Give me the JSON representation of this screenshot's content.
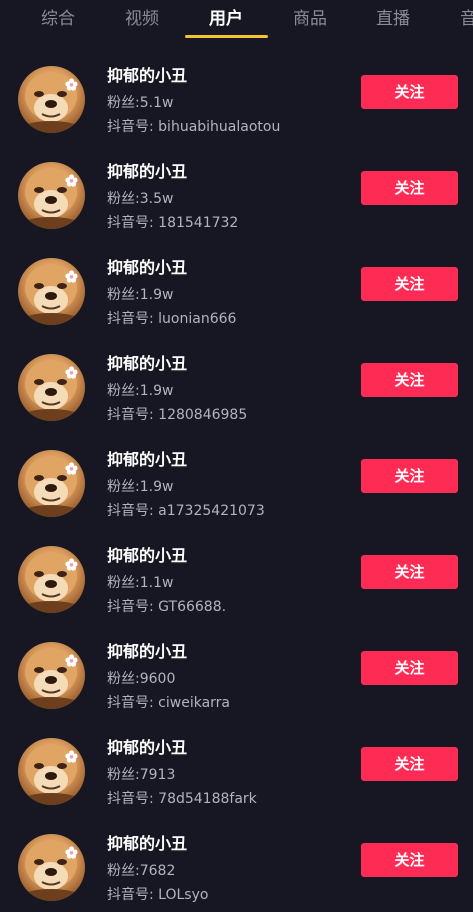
{
  "tabs": [
    {
      "label": "综合",
      "active": false
    },
    {
      "label": "视频",
      "active": false
    },
    {
      "label": "用户",
      "active": true
    },
    {
      "label": "商品",
      "active": false
    },
    {
      "label": "直播",
      "active": false
    },
    {
      "label": "音",
      "active": false
    }
  ],
  "colors": {
    "background": "#161722",
    "follow_button": "#fe2c55",
    "active_tab_underline": "#f4c430",
    "secondary_text": "#b3b4bb"
  },
  "users": [
    {
      "name": "抑郁的小丑",
      "fans": "粉丝:5.1w",
      "douyin_id": "抖音号: bihuabihualaotou",
      "follow_label": "关注"
    },
    {
      "name": "抑郁的小丑",
      "fans": "粉丝:3.5w",
      "douyin_id": "抖音号: 181541732",
      "follow_label": "关注"
    },
    {
      "name": "抑郁的小丑",
      "fans": "粉丝:1.9w",
      "douyin_id": "抖音号: luonian666",
      "follow_label": "关注"
    },
    {
      "name": "抑郁的小丑",
      "fans": "粉丝:1.9w",
      "douyin_id": "抖音号: 1280846985",
      "follow_label": "关注"
    },
    {
      "name": "抑郁的小丑",
      "fans": "粉丝:1.9w",
      "douyin_id": "抖音号: a17325421073",
      "follow_label": "关注"
    },
    {
      "name": "抑郁的小丑",
      "fans": "粉丝:1.1w",
      "douyin_id": "抖音号: GT66688.",
      "follow_label": "关注"
    },
    {
      "name": "抑郁的小丑",
      "fans": "粉丝:9600",
      "douyin_id": "抖音号: ciweikarra",
      "follow_label": "关注"
    },
    {
      "name": "抑郁的小丑",
      "fans": "粉丝:7913",
      "douyin_id": "抖音号: 78d54188fark",
      "follow_label": "关注"
    },
    {
      "name": "抑郁的小丑",
      "fans": "粉丝:7682",
      "douyin_id": "抖音号: LOLsyo",
      "follow_label": "关注"
    }
  ]
}
